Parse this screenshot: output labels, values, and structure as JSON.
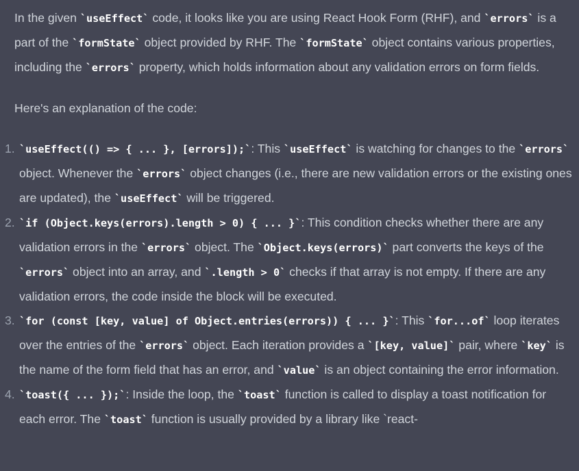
{
  "intro": "In the given `useEffect` code, it looks like you are using React Hook Form (RHF), and `errors` is a part of the `formState` object provided by RHF. The `formState` object contains various properties, including the `errors` property, which holds information about any validation errors on form fields.",
  "lead": "Here's an explanation of the code:",
  "list": [
    {
      "num": "1.",
      "text": "`useEffect(() => { ... }, [errors]);`: This `useEffect` is watching for changes to the `errors` object. Whenever the `errors` object changes (i.e., there are new validation errors or the existing ones are updated), the `useEffect` will be triggered."
    },
    {
      "num": "2.",
      "text": "`if (Object.keys(errors).length > 0) { ... }`: This condition checks whether there are any validation errors in the `errors` object. The `Object.keys(errors)` part converts the keys of the `errors` object into an array, and `.length > 0` checks if that array is not empty. If there are any validation errors, the code inside the block will be executed."
    },
    {
      "num": "3.",
      "text": "`for (const [key, value] of Object.entries(errors)) { ... }`: This `for...of` loop iterates over the entries of the `errors` object. Each iteration provides a `[key, value]` pair, where `key` is the name of the form field that has an error, and `value` is an object containing the error information."
    },
    {
      "num": "4.",
      "text": "`toast({ ... });`: Inside the loop, the `toast` function is called to display a toast notification for each error. The `toast` function is usually provided by a library like `react-"
    }
  ]
}
